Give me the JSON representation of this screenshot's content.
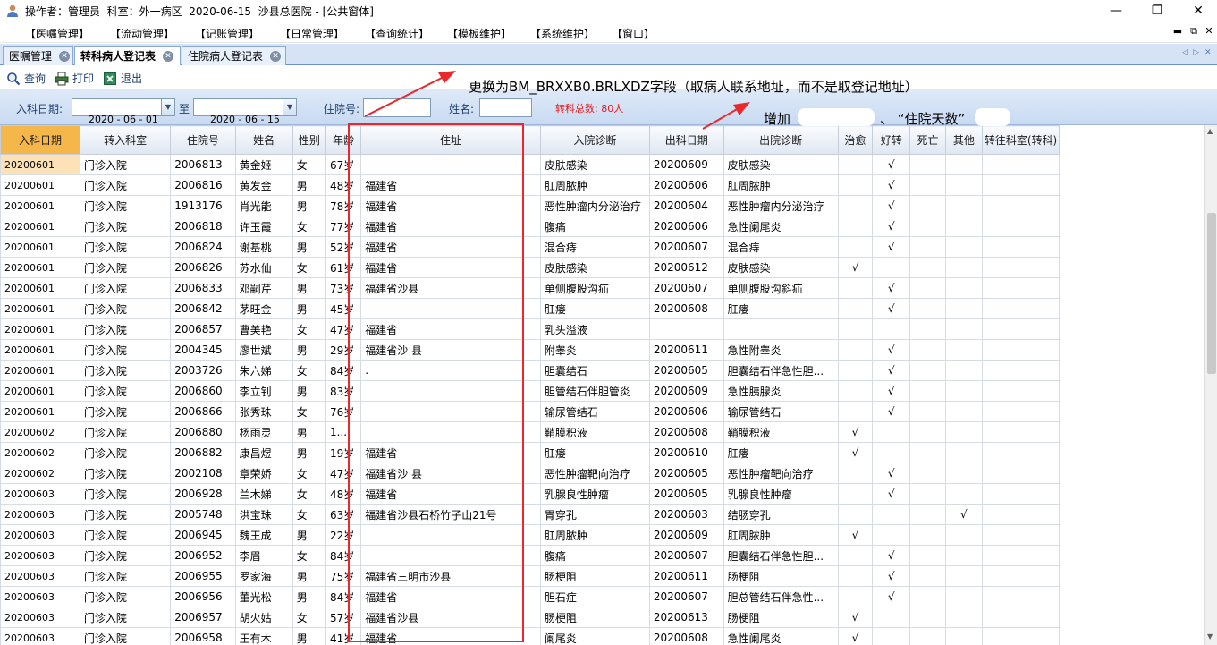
{
  "titlebar": {
    "title": "操作者：管理员  科室：外一病区  2020-06-15  沙县总医院 - [公共窗体]",
    "minimize": "—",
    "restore": "❐",
    "close": "✕"
  },
  "menubar": {
    "items": [
      "【医嘱管理】",
      "【流动管理】",
      "【记账管理】",
      "【日常管理】",
      "【查询统计】",
      "【模板维护】",
      "【系统维护】",
      "【窗口】"
    ],
    "mdi_min": "▬",
    "mdi_restore": "⧉",
    "mdi_close": "✕"
  },
  "tabs": [
    {
      "label": "医嘱管理"
    },
    {
      "label": "转科病人登记表"
    },
    {
      "label": "住院病人登记表"
    }
  ],
  "tab_close": "✕",
  "tab_nav": {
    "left": "◁",
    "right": "▷",
    "close": "✕"
  },
  "toolbar": {
    "query": "查询",
    "print": "打印",
    "exit": "退出"
  },
  "filter": {
    "admit_label": "入科日期:",
    "date_from": "2020 - 06 - 01",
    "to_label": "至",
    "date_to": "2020 - 06 - 15",
    "inpatient_label": "住院号:",
    "name_label": "姓名:",
    "total": "转科总数: 80人"
  },
  "annotations": {
    "note1": "更换为BM_BRXXB0.BRLXDZ字段（取病人联系地址，而不是取登记地址）",
    "note2_prefix": "增加",
    "note2_suffix": "、 “住院天数”"
  },
  "table": {
    "columns": [
      "入科日期",
      "转入科室",
      "住院号",
      "姓名",
      "性别",
      "年龄",
      "住址",
      "入院诊断",
      "出科日期",
      "出院诊断",
      "治愈",
      "好转",
      "死亡",
      "其他",
      "转往科室(转科)"
    ],
    "rows": [
      [
        "20200601",
        "门诊入院",
        "2006813",
        "黄金姬",
        "女",
        "67岁",
        "",
        "皮肤感染",
        "20200609",
        "皮肤感染",
        "",
        "√",
        "",
        "",
        ""
      ],
      [
        "20200601",
        "门诊入院",
        "2006816",
        "黄发金",
        "男",
        "48岁",
        "福建省",
        "肛周脓肿",
        "20200606",
        "肛周脓肿",
        "",
        "√",
        "",
        "",
        ""
      ],
      [
        "20200601",
        "门诊入院",
        "1913176",
        "肖光能",
        "男",
        "78岁",
        "福建省",
        "恶性肿瘤内分泌治疗",
        "20200604",
        "恶性肿瘤内分泌治疗",
        "",
        "√",
        "",
        "",
        ""
      ],
      [
        "20200601",
        "门诊入院",
        "2006818",
        "许玉霞",
        "女",
        "77岁",
        "福建省",
        "腹痛",
        "20200606",
        "急性阑尾炎",
        "",
        "√",
        "",
        "",
        ""
      ],
      [
        "20200601",
        "门诊入院",
        "2006824",
        "谢基桃",
        "男",
        "52岁",
        "福建省",
        "混合痔",
        "20200607",
        "混合痔",
        "",
        "√",
        "",
        "",
        ""
      ],
      [
        "20200601",
        "门诊入院",
        "2006826",
        "苏水仙",
        "女",
        "61岁",
        "福建省",
        "皮肤感染",
        "20200612",
        "皮肤感染",
        "√",
        "",
        "",
        "",
        ""
      ],
      [
        "20200601",
        "门诊入院",
        "2006833",
        "邓嗣芹",
        "男",
        "73岁",
        "福建省沙县",
        "单侧腹股沟疝",
        "20200607",
        "单侧腹股沟斜疝",
        "",
        "√",
        "",
        "",
        ""
      ],
      [
        "20200601",
        "门诊入院",
        "2006842",
        "茅旺金",
        "男",
        "45岁",
        "",
        "肛瘘",
        "20200608",
        "肛瘘",
        "",
        "√",
        "",
        "",
        ""
      ],
      [
        "20200601",
        "门诊入院",
        "2006857",
        "曹美艳",
        "女",
        "47岁",
        "福建省",
        "乳头溢液",
        "",
        "",
        "",
        "",
        "",
        "",
        ""
      ],
      [
        "20200601",
        "门诊入院",
        "2004345",
        "廖世斌",
        "男",
        "29岁",
        "福建省沙  县",
        "附睾炎",
        "20200611",
        "急性附睾炎",
        "",
        "√",
        "",
        "",
        ""
      ],
      [
        "20200601",
        "门诊入院",
        "2003726",
        "朱六娣",
        "女",
        "84岁",
        ".",
        "胆囊结石",
        "20200605",
        "胆囊结石伴急性胆...",
        "",
        "√",
        "",
        "",
        ""
      ],
      [
        "20200601",
        "门诊入院",
        "2006860",
        "李立钊",
        "男",
        "83岁",
        "",
        "胆管结石伴胆管炎",
        "20200609",
        "急性胰腺炎",
        "",
        "√",
        "",
        "",
        ""
      ],
      [
        "20200601",
        "门诊入院",
        "2006866",
        "张秀珠",
        "女",
        "76岁",
        "",
        "输尿管结石",
        "20200606",
        "输尿管结石",
        "",
        "√",
        "",
        "",
        ""
      ],
      [
        "20200602",
        "门诊入院",
        "2006880",
        "杨雨灵",
        "男",
        "1...",
        "",
        "鞘膜积液",
        "20200608",
        "鞘膜积液",
        "√",
        "",
        "",
        "",
        ""
      ],
      [
        "20200602",
        "门诊入院",
        "2006882",
        "康昌煜",
        "男",
        "19岁",
        "福建省",
        "肛瘘",
        "20200610",
        "肛瘘",
        "√",
        "",
        "",
        "",
        ""
      ],
      [
        "20200602",
        "门诊入院",
        "2002108",
        "章荣娇",
        "女",
        "47岁",
        "福建省沙  县",
        "恶性肿瘤靶向治疗",
        "20200605",
        "恶性肿瘤靶向治疗",
        "",
        "√",
        "",
        "",
        ""
      ],
      [
        "20200603",
        "门诊入院",
        "2006928",
        "兰木娣",
        "女",
        "48岁",
        "福建省",
        "乳腺良性肿瘤",
        "20200605",
        "乳腺良性肿瘤",
        "",
        "√",
        "",
        "",
        ""
      ],
      [
        "20200603",
        "门诊入院",
        "2005748",
        "洪宝珠",
        "女",
        "63岁",
        "福建省沙县石桥竹子山21号",
        "胃穿孔",
        "20200603",
        "结肠穿孔",
        "",
        "",
        "",
        "√",
        ""
      ],
      [
        "20200603",
        "门诊入院",
        "2006945",
        "魏王成",
        "男",
        "22岁",
        "",
        "肛周脓肿",
        "20200609",
        "肛周脓肿",
        "√",
        "",
        "",
        "",
        ""
      ],
      [
        "20200603",
        "门诊入院",
        "2006952",
        "李眉",
        "女",
        "84岁",
        "",
        "腹痛",
        "20200607",
        "胆囊结石伴急性胆...",
        "",
        "√",
        "",
        "",
        ""
      ],
      [
        "20200603",
        "门诊入院",
        "2006955",
        "罗家海",
        "男",
        "75岁",
        "福建省三明市沙县",
        "肠梗阻",
        "20200611",
        "肠梗阻",
        "",
        "√",
        "",
        "",
        ""
      ],
      [
        "20200603",
        "门诊入院",
        "2006956",
        "董光松",
        "男",
        "84岁",
        "福建省",
        "胆石症",
        "20200607",
        "胆总管结石伴急性...",
        "",
        "√",
        "",
        "",
        ""
      ],
      [
        "20200603",
        "门诊入院",
        "2006957",
        "胡火姑",
        "女",
        "57岁",
        "福建省沙县",
        "肠梗阻",
        "20200613",
        "肠梗阻",
        "√",
        "",
        "",
        "",
        ""
      ],
      [
        "20200603",
        "门诊入院",
        "2006958",
        "王有木",
        "男",
        "41岁",
        "福建省",
        "阑尾炎",
        "20200608",
        "急性阑尾炎",
        "√",
        "",
        "",
        "",
        ""
      ]
    ]
  },
  "colors": {
    "annotation_red": "#e8282d",
    "header_selected": "#f5b64a",
    "total_red": "#e0191e"
  }
}
